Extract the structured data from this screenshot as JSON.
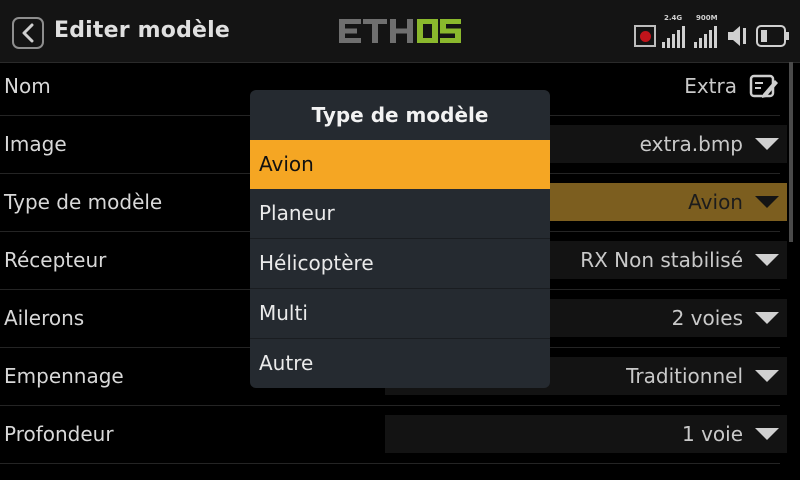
{
  "header": {
    "title": "Editer modèle",
    "logo_text": "ETHOS",
    "signal_24": "2.4G",
    "signal_900": "900M"
  },
  "rows": [
    {
      "label": "Nom",
      "value": "Extra",
      "control": "edit"
    },
    {
      "label": "Image",
      "value": "extra.bmp",
      "control": "dropdown"
    },
    {
      "label": "Type de modèle",
      "value": "Avion",
      "control": "dropdown",
      "active": true
    },
    {
      "label": "Récepteur",
      "value": "RX Non stabilisé",
      "control": "dropdown"
    },
    {
      "label": "Ailerons",
      "value": "2 voies",
      "control": "dropdown"
    },
    {
      "label": "Empennage",
      "value": "Traditionnel",
      "control": "dropdown"
    },
    {
      "label": "Profondeur",
      "value": "1 voie",
      "control": "dropdown"
    }
  ],
  "modal": {
    "title": "Type de modèle",
    "options": [
      "Avion",
      "Planeur",
      "Hélicoptère",
      "Multi",
      "Autre"
    ],
    "selected": "Avion"
  },
  "colors": {
    "accent": "#f5a623",
    "logo_green": "#8ab82d",
    "active_field": "#7c5e1f",
    "record_red": "#c0141b"
  }
}
